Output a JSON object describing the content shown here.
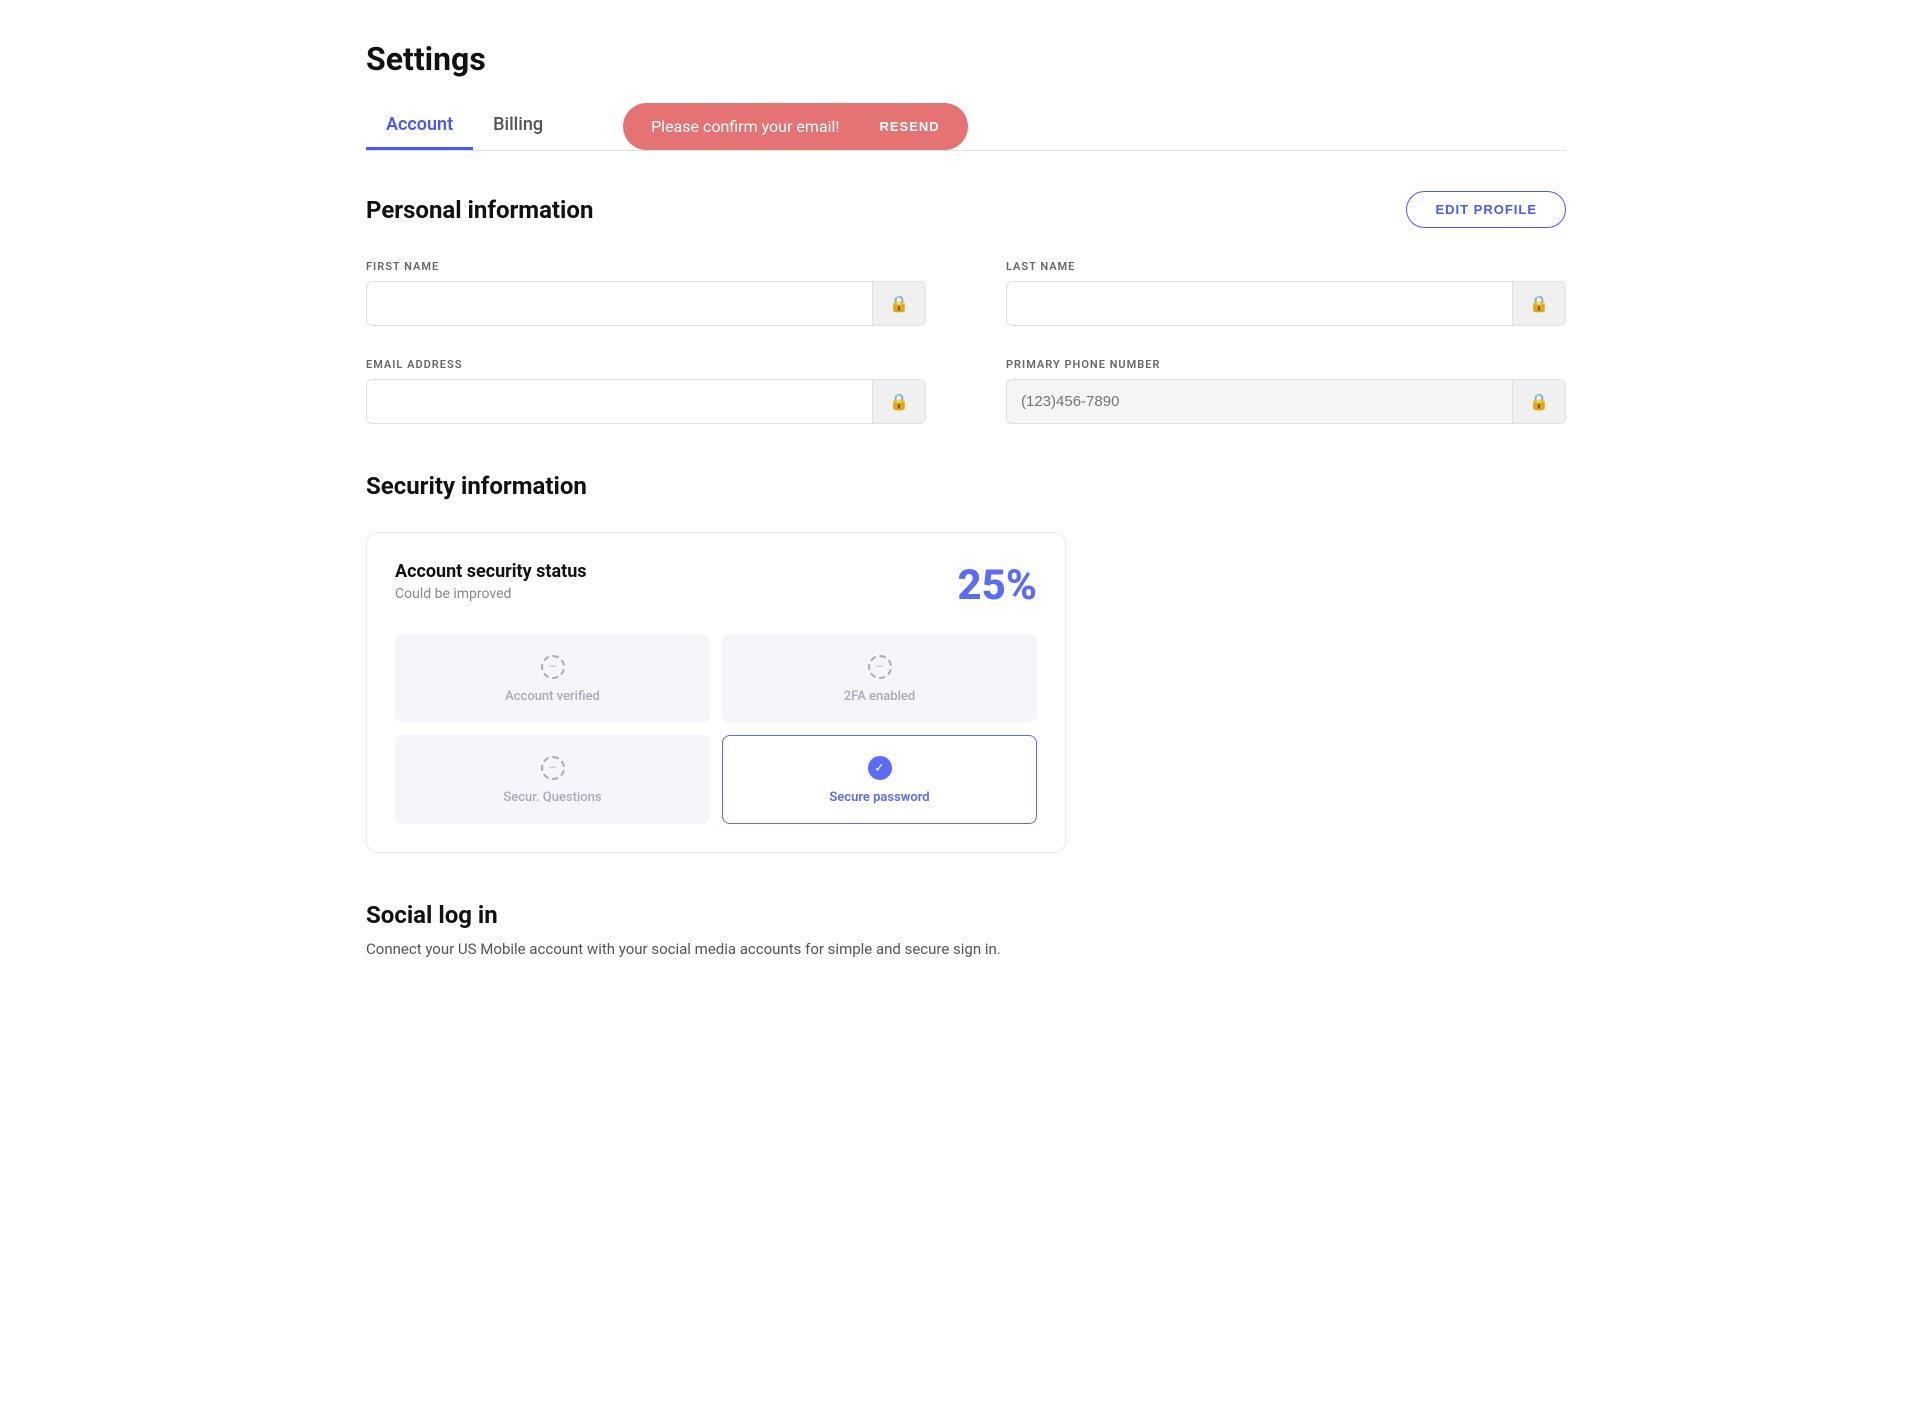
{
  "page": {
    "title": "Settings"
  },
  "tabs": [
    {
      "id": "account",
      "label": "Account",
      "active": true
    },
    {
      "id": "billing",
      "label": "Billing",
      "active": false
    }
  ],
  "email_banner": {
    "message": "Please confirm your email!",
    "resend_label": "RESEND"
  },
  "personal_info": {
    "title": "Personal information",
    "edit_button": "EDIT PROFILE",
    "fields": {
      "first_name_label": "FIRST NAME",
      "last_name_label": "LAST NAME",
      "email_label": "EMAIL ADDRESS",
      "phone_label": "PRIMARY PHONE NUMBER",
      "phone_placeholder": "(123)456-7890",
      "first_name_value": "",
      "last_name_value": "",
      "email_value": ""
    }
  },
  "security_info": {
    "title": "Security information",
    "card": {
      "title": "Account security status",
      "subtitle": "Could be improved",
      "percentage": "25%",
      "items": [
        {
          "id": "account-verified",
          "label": "Account verified",
          "active": false,
          "checked": false
        },
        {
          "id": "2fa-enabled",
          "label": "2FA enabled",
          "active": false,
          "checked": false
        },
        {
          "id": "security-questions",
          "label": "Secur. Questions",
          "active": false,
          "checked": false
        },
        {
          "id": "secure-password",
          "label": "Secure password",
          "active": true,
          "checked": true
        }
      ]
    }
  },
  "social_login": {
    "title": "Social log in",
    "description": "Connect your US Mobile account with your social media accounts for simple and secure sign in."
  }
}
